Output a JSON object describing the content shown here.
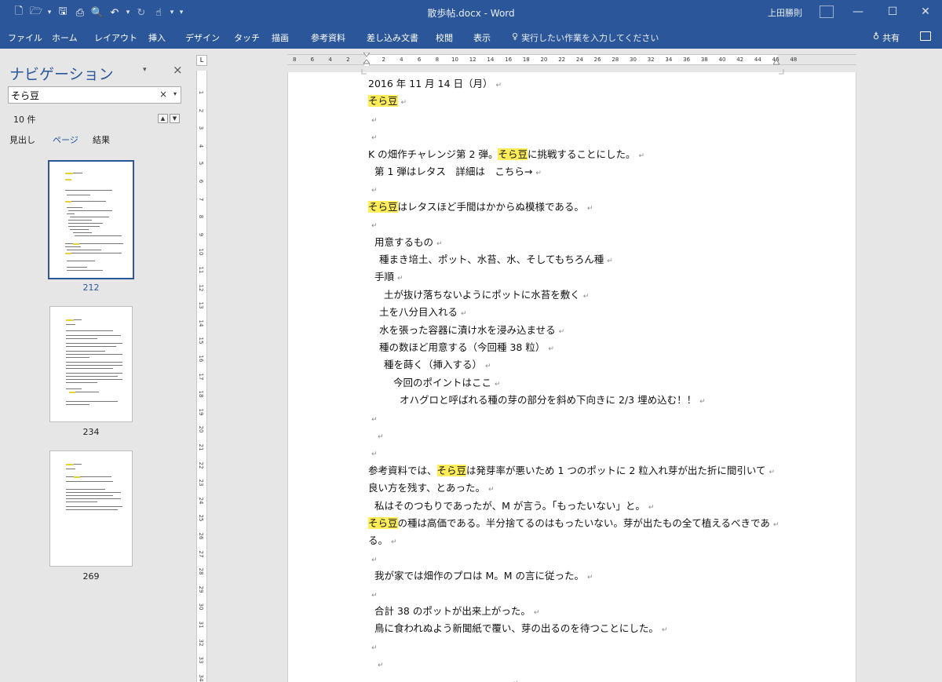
{
  "titlebar": {
    "doc_title": "散歩帖.docx - Word",
    "user": "上田勝則",
    "minimize": "—",
    "maximize": "☐",
    "close": "✕"
  },
  "qat": {
    "new": "🗋",
    "open": "🗁",
    "save": "🖫",
    "print": "⎙",
    "preview": "🔍",
    "undo": "↶",
    "redo": "↻",
    "touch": "☝",
    "dropdown": "▾"
  },
  "ribbon": {
    "tabs": [
      "ファイル",
      "ホーム",
      "レイアウト",
      "挿入",
      "デザイン",
      "タッチ",
      "描画",
      "参考資料",
      "差し込み文書",
      "校閲",
      "表示"
    ],
    "tell_me_icon": "♀",
    "tell_me": "実行したい作業を入力してください",
    "share_icon": "♁",
    "share": "共有"
  },
  "navigation": {
    "title": "ナビゲーション",
    "options_icon": "▾",
    "close_icon": "×",
    "search_value": "そら豆",
    "search_clear": "×",
    "search_dropdown": "▾",
    "result_count": "10 件",
    "prev": "▲",
    "next": "▼",
    "tabs": [
      "見出し",
      "ページ",
      "結果"
    ],
    "active_tab": "ページ",
    "thumbnails": [
      {
        "page": "212",
        "selected": true
      },
      {
        "page": "234",
        "selected": false
      },
      {
        "page": "269",
        "selected": false
      }
    ]
  },
  "ruler": {
    "tab_selector": "L",
    "left_numbers": [
      "8",
      "6",
      "4",
      "2"
    ],
    "right_numbers": [
      "2",
      "4",
      "6",
      "8",
      "10",
      "12",
      "14",
      "16",
      "18",
      "20",
      "22",
      "24",
      "26",
      "28",
      "30",
      "32",
      "34",
      "36",
      "38",
      "40",
      "42",
      "44",
      "46",
      "48"
    ],
    "vertical_numbers": [
      "1",
      "2",
      "3",
      "4",
      "5",
      "6",
      "7",
      "8",
      "9",
      "10",
      "11",
      "12",
      "13",
      "14",
      "15",
      "16",
      "17",
      "18",
      "19",
      "20",
      "21",
      "22",
      "23",
      "24",
      "25",
      "26",
      "27",
      "28",
      "29",
      "30",
      "31",
      "32",
      "33",
      "34"
    ]
  },
  "document": {
    "highlight_term": "そら豆",
    "paragraph_mark": "↵",
    "lines": [
      {
        "segments": [
          {
            "t": "2016 年 11 月 14 日（月）"
          }
        ],
        "indent": 0
      },
      {
        "segments": [
          {
            "t": "そら豆",
            "hl": true
          }
        ],
        "indent": 0
      },
      {
        "segments": [],
        "indent": 0
      },
      {
        "segments": [],
        "indent": 0
      },
      {
        "segments": [
          {
            "t": "K の畑作チャレンジ第 2 弾。"
          },
          {
            "t": "そら豆",
            "hl": true
          },
          {
            "t": "に挑戦することにした。"
          }
        ],
        "indent": 0
      },
      {
        "segments": [
          {
            "t": "第 1 弾はレタス　詳細は　こちら→"
          }
        ],
        "indent": 8
      },
      {
        "segments": [],
        "indent": 0
      },
      {
        "segments": [
          {
            "t": "そら豆",
            "hl": true
          },
          {
            "t": "はレタスほど手間はかからぬ模様である。"
          }
        ],
        "indent": 0
      },
      {
        "segments": [],
        "indent": 0
      },
      {
        "segments": [
          {
            "t": "用意するもの"
          }
        ],
        "indent": 8
      },
      {
        "segments": [
          {
            "t": "種まき培土、ポット、水苔、水、そしてもちろん種"
          }
        ],
        "indent": 14
      },
      {
        "segments": [
          {
            "t": "手順"
          }
        ],
        "indent": 8
      },
      {
        "segments": [
          {
            "t": "土が抜け落ちないようにポットに水苔を敷く"
          }
        ],
        "indent": 20
      },
      {
        "segments": [
          {
            "t": "土を八分目入れる"
          }
        ],
        "indent": 14
      },
      {
        "segments": [
          {
            "t": "水を張った容器に漬け水を浸み込ませる"
          }
        ],
        "indent": 14
      },
      {
        "segments": [
          {
            "t": "種の数ほど用意する（今回種 38 粒）"
          }
        ],
        "indent": 14
      },
      {
        "segments": [
          {
            "t": "種を蒔く（挿入する）"
          }
        ],
        "indent": 20
      },
      {
        "segments": [
          {
            "t": "今回のポイントはここ"
          }
        ],
        "indent": 32
      },
      {
        "segments": [
          {
            "t": "オハグロと呼ばれる種の芽の部分を斜め下向きに 2/3 埋め込む！！"
          }
        ],
        "indent": 40
      },
      {
        "segments": [],
        "indent": 0
      },
      {
        "segments": [],
        "indent": 8
      },
      {
        "segments": [],
        "indent": 0
      },
      {
        "segments": [
          {
            "t": "参考資料では、"
          },
          {
            "t": "そら豆",
            "hl": true
          },
          {
            "t": "は発芽率が悪いため 1 つのポットに 2 粒入れ芽が出た折に間引いて"
          }
        ],
        "indent": 0
      },
      {
        "segments": [
          {
            "t": "良い方を残す、とあった。"
          }
        ],
        "indent": 0
      },
      {
        "segments": [
          {
            "t": "私はそのつもりであったが、M が言う。「もったいない」と。"
          }
        ],
        "indent": 8
      },
      {
        "segments": [
          {
            "t": "そら豆",
            "hl": true
          },
          {
            "t": "の種は高価である。半分捨てるのはもったいない。芽が出たもの全て植えるべきであ"
          }
        ],
        "indent": 0
      },
      {
        "segments": [
          {
            "t": "る。"
          }
        ],
        "indent": 0
      },
      {
        "segments": [],
        "indent": 0
      },
      {
        "segments": [
          {
            "t": "我が家では畑作のプロは M。M の言に従った。"
          }
        ],
        "indent": 8
      },
      {
        "segments": [],
        "indent": 0
      },
      {
        "segments": [
          {
            "t": "合計 38 のポットが出来上がった。"
          }
        ],
        "indent": 8
      },
      {
        "segments": [
          {
            "t": "鳥に食われぬよう新聞紙で覆い、芽の出るのを待つことにした。"
          }
        ],
        "indent": 8
      },
      {
        "segments": [],
        "indent": 0
      },
      {
        "segments": [],
        "indent": 8
      },
      {
        "segments": [],
        "indent": 180
      }
    ]
  },
  "colors": {
    "accent": "#2b579a",
    "highlight": "#ffee58",
    "background": "#e6e6e6"
  }
}
